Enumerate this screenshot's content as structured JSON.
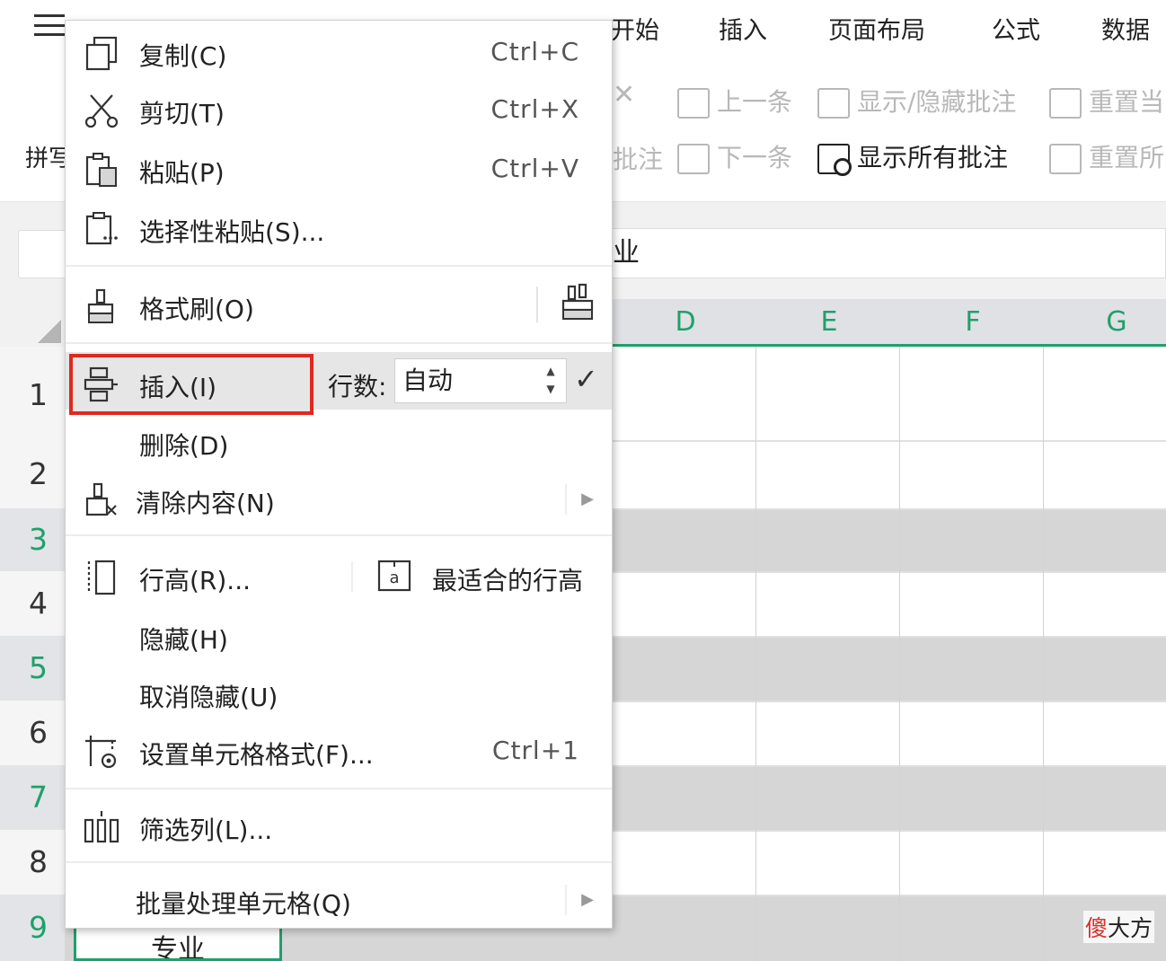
{
  "ribbon": {
    "tabs": [
      "开始",
      "插入",
      "页面布局",
      "公式",
      "数据"
    ],
    "left_fragment": "拼写",
    "comment_fragment": "批注",
    "review": {
      "prev": "上一条",
      "next": "下一条",
      "toggle": "显示/隐藏批注",
      "show_all": "显示所有批注",
      "reset1": "重置当",
      "reset2": "重置所"
    }
  },
  "formula_bar": {
    "text": "业"
  },
  "columns": [
    "D",
    "E",
    "F",
    "G"
  ],
  "rows": [
    "1",
    "2",
    "3",
    "4",
    "5",
    "6",
    "7",
    "8",
    "9"
  ],
  "active_cell_text": "专业",
  "context_menu": {
    "copy": {
      "label": "复制(C)",
      "shortcut": "Ctrl+C"
    },
    "cut": {
      "label": "剪切(T)",
      "shortcut": "Ctrl+X"
    },
    "paste": {
      "label": "粘贴(P)",
      "shortcut": "Ctrl+V"
    },
    "paste_special": {
      "label": "选择性粘贴(S)..."
    },
    "format_painter": {
      "label": "格式刷(O)"
    },
    "insert": {
      "label": "插入(I)",
      "rows_label": "行数:",
      "rows_value": "自动"
    },
    "delete": {
      "label": "删除(D)"
    },
    "clear": {
      "label": "清除内容(N)"
    },
    "row_height": {
      "label": "行高(R)...",
      "best_fit": "最适合的行高"
    },
    "hide": {
      "label": "隐藏(H)"
    },
    "unhide": {
      "label": "取消隐藏(U)"
    },
    "format_cells": {
      "label": "设置单元格格式(F)...",
      "shortcut": "Ctrl+1"
    },
    "filter_column": {
      "label": "筛选列(L)..."
    },
    "batch": {
      "label": "批量处理单元格(Q)"
    }
  },
  "watermark": {
    "part1": "傻",
    "part2": "大方"
  },
  "colors": {
    "accent_green": "#1fa06b",
    "highlight_red": "#e0281e"
  }
}
